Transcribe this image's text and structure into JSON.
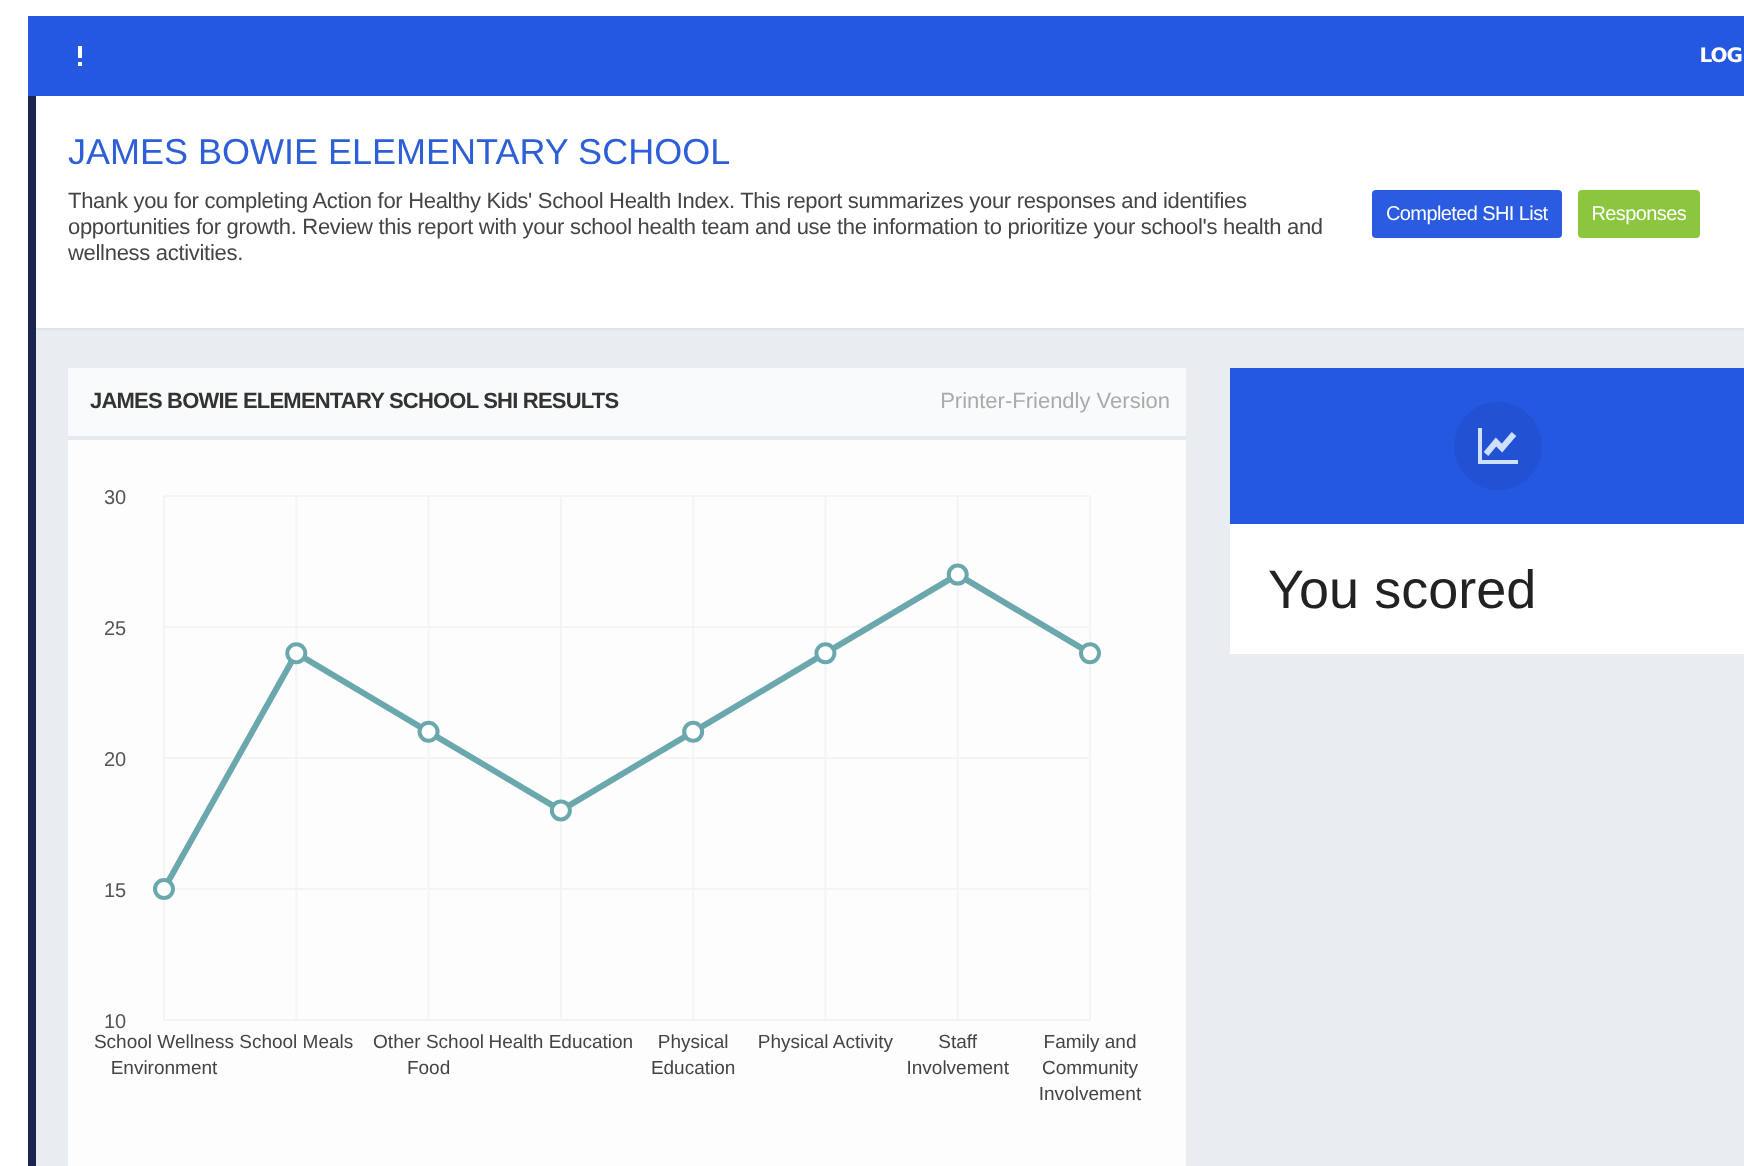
{
  "top_bar": {
    "right_link": "LOG"
  },
  "header": {
    "title": "JAMES BOWIE ELEMENTARY SCHOOL",
    "description": "Thank you for completing Action for Healthy Kids' School Health Index. This report summarizes your responses and identifies opportunities for growth. Review this report with your school health team and use the information to prioritize your school's health and wellness activities.",
    "buttons": [
      {
        "label": "Completed SHI List",
        "kind": "primary"
      },
      {
        "label": "Responses",
        "kind": "success"
      }
    ]
  },
  "results_card": {
    "title": "JAMES BOWIE ELEMENTARY SCHOOL SHI RESULTS",
    "printer_link": "Printer-Friendly Version",
    "chart_data": {
      "type": "line",
      "categories": [
        [
          "School Wellness",
          "Environment"
        ],
        [
          "School Meals"
        ],
        [
          "Other School",
          "Food"
        ],
        [
          "Health Education"
        ],
        [
          "Physical",
          "Education"
        ],
        [
          "Physical Activity"
        ],
        [
          "Staff",
          "Involvement"
        ],
        [
          "Family and",
          "Community",
          "Involvement"
        ]
      ],
      "series": [
        {
          "color": "#6aa8ad",
          "marker": true,
          "values": [
            15,
            24,
            21,
            18,
            21,
            24,
            27,
            24
          ]
        }
      ],
      "grid": true,
      "ylim": [
        10,
        30
      ],
      "yticks": [
        10,
        15,
        20,
        25,
        30
      ]
    }
  },
  "score_card": {
    "text": "You scored"
  }
}
